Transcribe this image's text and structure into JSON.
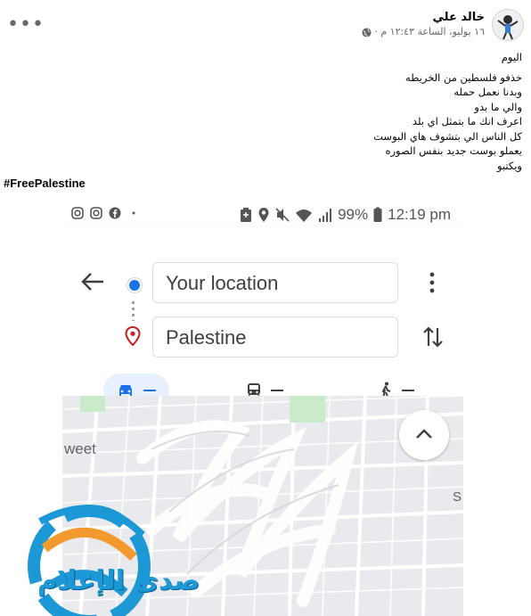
{
  "post": {
    "author": "خالد علي",
    "meta_text": "١٦ يوليو، الساعة ١٢:٤٣ م ·",
    "more_label": "•••",
    "body_lines": [
      "اليوم",
      "خذفو فلسطين من الخريطه",
      "وبدنا نعمل حمله",
      "والي ما بدو",
      "اعرف انك ما بتمثل اي بلد",
      "كل الناس الي بتشوف هاي البوست",
      "يعملو بوست جديد بنفس الصوره",
      "ويكتبو"
    ],
    "hashtag": "#FreePalestine"
  },
  "screenshot": {
    "status_time": "12:19 pm",
    "battery": "99%",
    "route": {
      "from_value": "Your location",
      "to_value": "Palestine"
    },
    "modes": [
      {
        "icon": "car-icon",
        "value": "—"
      },
      {
        "icon": "transit-icon",
        "value": "—"
      },
      {
        "icon": "walk-icon",
        "value": "—"
      }
    ],
    "map_labels": [
      "weet",
      "S"
    ]
  },
  "watermark": {
    "text": "صدى الإعلام"
  },
  "colors": {
    "accent": "#1a73e8",
    "pin": "#c5221f",
    "watermark_blue": "#1b98d5",
    "watermark_orange": "#f29a2e"
  }
}
